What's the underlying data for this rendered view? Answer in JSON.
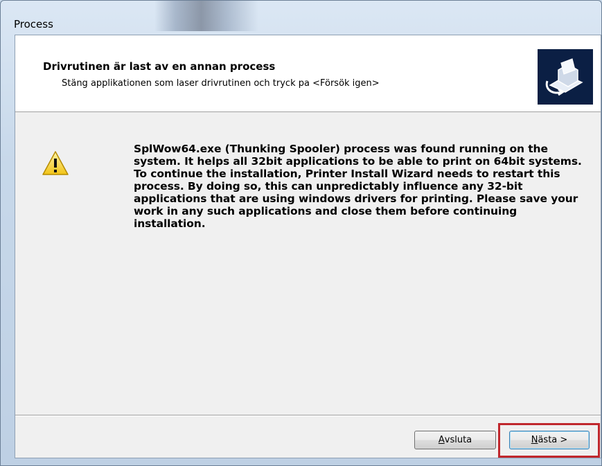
{
  "window": {
    "title": "Process"
  },
  "header": {
    "title": "Drivrutinen är last av en annan process",
    "subtitle": "Stäng applikationen som laser drivrutinen och tryck pa <Försök igen>",
    "icon": "printer-install-icon"
  },
  "body": {
    "icon": "warning-icon",
    "message": "SplWow64.exe (Thunking Spooler) process was found running on the system. It helps all 32bit applications to be able to print on 64bit systems. To continue the installation, Printer Install Wizard needs to restart this process. By doing so, this can unpredictably influence any 32-bit applications that are using windows drivers for printing. Please save your work in any such applications and close them before continuing installation."
  },
  "buttons": {
    "cancel": {
      "mnemonic": "A",
      "rest": "vsluta"
    },
    "next": {
      "mnemonic": "N",
      "rest": "ästa >"
    }
  },
  "colors": {
    "highlight": "#c0272d",
    "header_icon_bg": "#0b1f44"
  }
}
